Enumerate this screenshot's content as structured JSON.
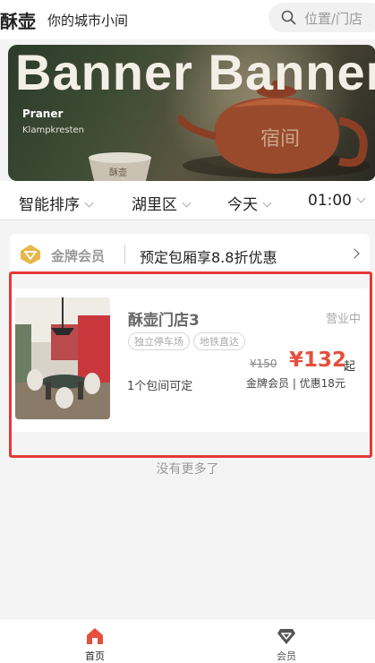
{
  "header": {
    "brand": "酥壶",
    "slogan": "你的城市小间",
    "search_placeholder": "位置/门店"
  },
  "banner": {
    "headline": "Banner Banner",
    "sub_title": "Praner",
    "sub_text": "Klampkresten",
    "teapot_text": "宿间",
    "cup_text": "酥壶"
  },
  "filters": {
    "sort": "智能排序",
    "district": "湖里区",
    "date": "今天",
    "time": "01:00"
  },
  "member_bar": {
    "label": "金牌会员",
    "offer": "预定包厢享8.8折优惠"
  },
  "store": {
    "name": "酥壶门店3",
    "status": "营业中",
    "tags": [
      "独立停车场",
      "地铁直达"
    ],
    "rooms_available": "1个包间可定",
    "original_price": "¥150",
    "price": "¥132",
    "price_suffix": "起",
    "member_discount": "金牌会员 | 优惠18元"
  },
  "list_end": "没有更多了",
  "tabbar": {
    "home": "首页",
    "member": "会员"
  },
  "colors": {
    "accent": "#e5503c",
    "highlight_border": "#e53935",
    "gold": "#e6b84a"
  },
  "icons": {
    "search": "search-icon",
    "diamond": "diamond-icon",
    "home": "home-icon",
    "member": "member-diamond-icon"
  }
}
